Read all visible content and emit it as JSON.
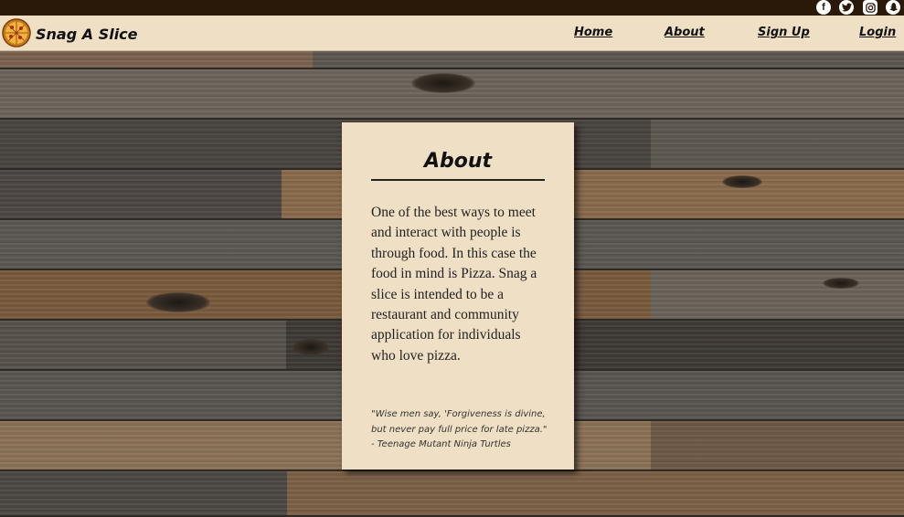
{
  "social": {
    "icons": [
      "facebook-icon",
      "twitter-icon",
      "instagram-icon",
      "snapchat-icon"
    ]
  },
  "header": {
    "brand": "Snag A Slice",
    "logo_icon": "pizza-icon",
    "nav": {
      "home": "Home",
      "about": "About",
      "signup": "Sign Up",
      "login": "Login"
    }
  },
  "card": {
    "title": "About",
    "body": "One of the best ways to meet and interact with people is through food. In this case the food in mind is Pizza. Snag a slice is intended to be a restaurant and community application for individuals who love pizza.",
    "quote_line1": "\"Wise men say, 'Forgiveness is divine,",
    "quote_line2": "but never pay full price for late pizza.\"",
    "quote_line3": "- Teenage Mutant Ninja Turtles"
  },
  "colors": {
    "topbar": "#2a1808",
    "cream": "#efdfc4",
    "text": "#111111"
  }
}
